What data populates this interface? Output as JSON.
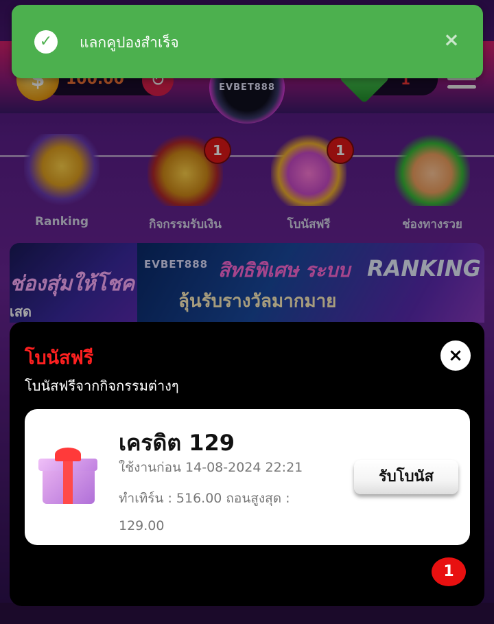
{
  "toast": {
    "message": "แลกคูปองสำเร็จ",
    "close_glyph": "×",
    "check_glyph": "✓"
  },
  "header": {
    "balance": "100.00",
    "coin_glyph": "$",
    "refresh_glyph": "↻",
    "logo_text": "EVBET888",
    "gem_count": "1"
  },
  "menu": [
    {
      "label": "Ranking",
      "badge": "",
      "icon": "ranking-star-icon"
    },
    {
      "label": "กิจกรรมรับเงิน",
      "badge": "1",
      "icon": "treasure-chest-icon"
    },
    {
      "label": "โบนัสฟรี",
      "badge": "1",
      "icon": "gift-coins-icon"
    },
    {
      "label": "ช่องทางรวย",
      "badge": "",
      "icon": "money-hand-icon"
    }
  ],
  "banners": {
    "left_title": "ช่องสุ่มให้โชค",
    "left_sub": "เสด",
    "brand": "EVBET888",
    "main_title": "สิทธิพิเศษ ระบบ",
    "main_rank": "RANKING",
    "main_sub": "ลุ้นรับรางวัลมากมาย"
  },
  "modal": {
    "title": "โบนัสฟรี",
    "subtitle": "โบนัสฟรีจากกิจกรรมต่างๆ",
    "close_glyph": "×",
    "card": {
      "title": "เครดิต 129",
      "expire": "ใช้งานก่อน 14-08-2024 22:21",
      "turnover": "ทำเทิร์น : 516.00  ถอนสูงสุด : 129.00",
      "claim_label": "รับโบนัส"
    },
    "page_badge": "1"
  },
  "colors": {
    "toast_bg": "#4cb04e",
    "modal_title": "#ff2020",
    "badge": "#e01818"
  }
}
